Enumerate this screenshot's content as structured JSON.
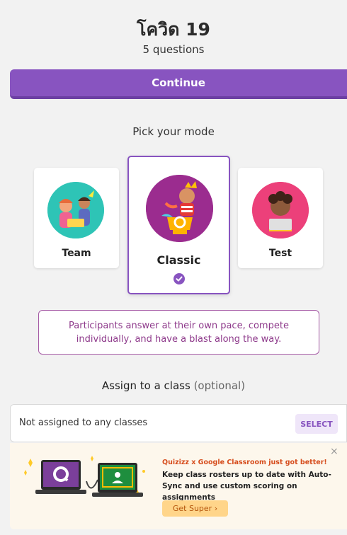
{
  "quiz": {
    "title": "โควิด 19",
    "subtitle": "5 questions"
  },
  "actions": {
    "continue_label": "Continue"
  },
  "modes": {
    "heading": "Pick your mode",
    "items": [
      {
        "label": "Team"
      },
      {
        "label": "Classic"
      },
      {
        "label": "Test"
      }
    ],
    "selected_description": "Participants answer at their own pace, compete individually, and have a blast along the way."
  },
  "assign": {
    "heading": "Assign to a class",
    "optional_label": "(optional)",
    "value": "Not assigned to any classes",
    "select_label": "SELECT"
  },
  "promo": {
    "close": "×",
    "tagline": "Quizizz x Google Classroom just got better!",
    "body": "Keep class rosters up to date with Auto-Sync and use custom scoring on assignments",
    "cta": "Get Super ›"
  },
  "colors": {
    "accent": "#8854c0",
    "tooltip_text": "#8e3a8b",
    "promo_bg": "#fdf7ec",
    "promo_button": "#ffd58a"
  }
}
